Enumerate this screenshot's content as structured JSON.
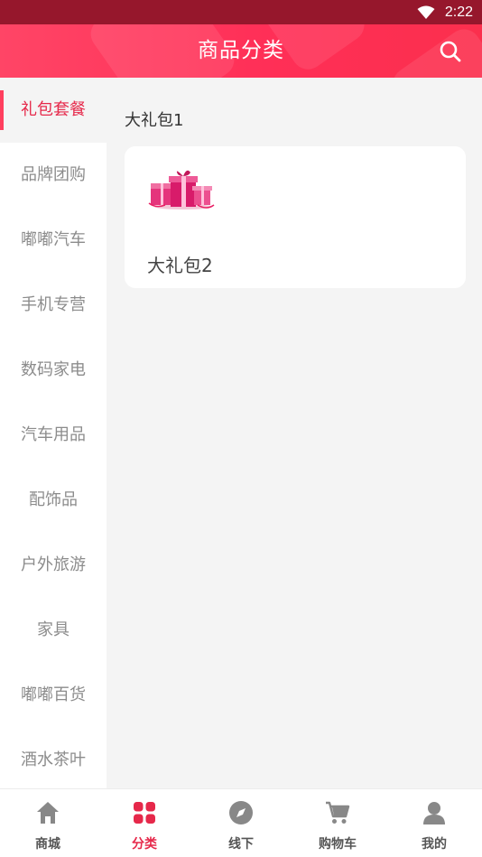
{
  "status_bar": {
    "time": "2:22",
    "wifi_icon": "wifi-icon"
  },
  "header": {
    "title": "商品分类",
    "search_icon": "search-icon"
  },
  "sidebar": {
    "items": [
      {
        "label": "礼包套餐",
        "active": true
      },
      {
        "label": "品牌团购"
      },
      {
        "label": "嘟嘟汽车"
      },
      {
        "label": "手机专营"
      },
      {
        "label": "数码家电"
      },
      {
        "label": "汽车用品"
      },
      {
        "label": "配饰品"
      },
      {
        "label": "户外旅游"
      },
      {
        "label": "家具"
      },
      {
        "label": "嘟嘟百货"
      },
      {
        "label": "酒水茶叶"
      }
    ]
  },
  "content": {
    "section_title": "大礼包1",
    "products": [
      {
        "name": "大礼包2",
        "image_icon": "gift-box-icon"
      }
    ]
  },
  "tabbar": {
    "tabs": [
      {
        "label": "商城",
        "icon": "home-icon"
      },
      {
        "label": "分类",
        "icon": "category-grid-icon",
        "active": true
      },
      {
        "label": "线下",
        "icon": "compass-icon"
      },
      {
        "label": "购物车",
        "icon": "cart-icon"
      },
      {
        "label": "我的",
        "icon": "user-icon"
      }
    ]
  },
  "colors": {
    "accent": "#e6284a",
    "header": "#ff3358",
    "status_bar": "#96172c"
  }
}
